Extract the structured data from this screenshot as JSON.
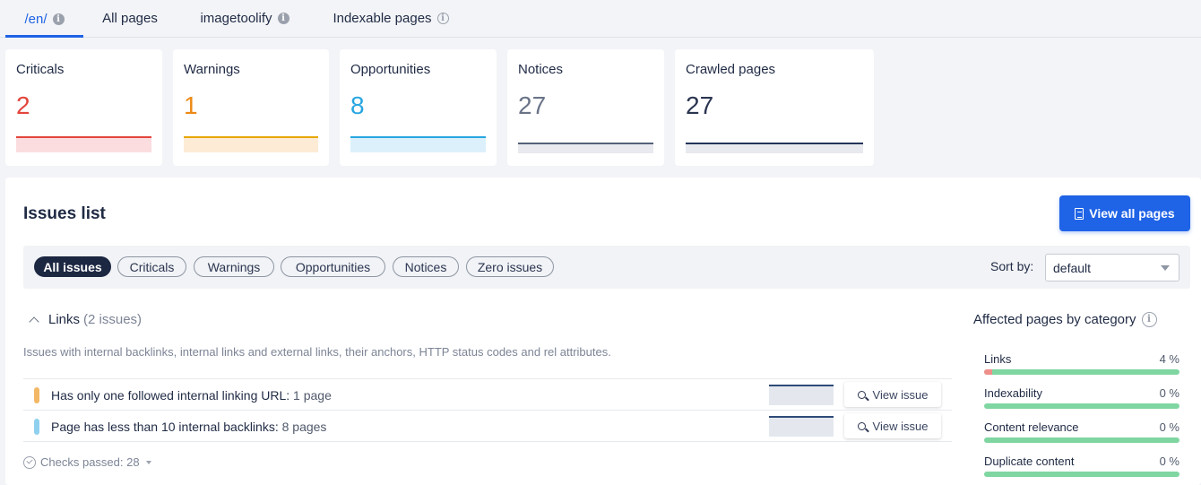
{
  "tabs": [
    {
      "label": "/en/",
      "active": true,
      "info": "filled"
    },
    {
      "label": "All pages",
      "active": false,
      "info": null
    },
    {
      "label": "imagetoolify",
      "active": false,
      "info": "filled"
    },
    {
      "label": "Indexable pages",
      "active": false,
      "info": "outline"
    }
  ],
  "cards": [
    {
      "label": "Criticals",
      "value": "2",
      "color": "#e2453c",
      "line": "#e2453c",
      "fill": "#fbdde0"
    },
    {
      "label": "Warnings",
      "value": "1",
      "color": "#eb8a16",
      "line": "#e7a700",
      "fill": "#fdebd6"
    },
    {
      "label": "Opportunities",
      "value": "8",
      "color": "#27a6e0",
      "line": "#27a6e0",
      "fill": "#dcf0fb"
    },
    {
      "label": "Notices",
      "value": "27",
      "color": "#6a7488",
      "line": "#55617a",
      "fill": "#e8eaef"
    },
    {
      "label": "Crawled pages",
      "value": "27",
      "color": "#2b3550",
      "line": "#22345a",
      "fill": "#e8eaef"
    }
  ],
  "issues": {
    "title": "Issues list",
    "view_all_label": "View all pages",
    "filters": [
      "All issues",
      "Criticals",
      "Warnings",
      "Opportunities",
      "Notices",
      "Zero issues"
    ],
    "active_filter": "All issues",
    "sort_label": "Sort by:",
    "sort_value": "default",
    "section": {
      "name": "Links",
      "count": "(2 issues)",
      "description": "Issues with internal backlinks, internal links and external links, their anchors, HTTP status codes and rel attributes."
    },
    "rows": [
      {
        "text": "Has only one followed internal linking URL:",
        "pages": "1 page",
        "color": "#f2b866",
        "action": "View issue"
      },
      {
        "text": "Page has less than 10 internal backlinks:",
        "pages": "8 pages",
        "color": "#8fd0ef",
        "action": "View issue"
      }
    ],
    "checks_passed": "Checks passed: 28"
  },
  "affected": {
    "title": "Affected pages by category",
    "categories": [
      {
        "name": "Links",
        "pct": "4 %",
        "fraction": 0.04
      },
      {
        "name": "Indexability",
        "pct": "0 %",
        "fraction": 0
      },
      {
        "name": "Content relevance",
        "pct": "0 %",
        "fraction": 0
      },
      {
        "name": "Duplicate content",
        "pct": "0 %",
        "fraction": 0
      }
    ]
  }
}
